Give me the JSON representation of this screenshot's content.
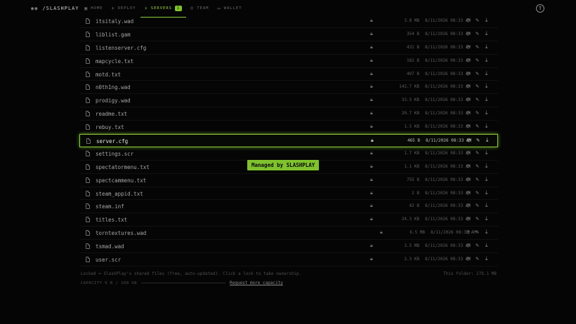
{
  "brand": {
    "logo_icon": "controller-icon",
    "name": "/SLASHPLAY"
  },
  "nav": [
    {
      "label": "HOME",
      "icon": "▣",
      "active": false
    },
    {
      "label": "DEPLOY",
      "icon": "+",
      "active": false
    },
    {
      "label": "SERVERS",
      "icon": "⚡",
      "active": true,
      "badge": "1"
    },
    {
      "label": "TEAM",
      "icon": "☺",
      "active": false
    },
    {
      "label": "WALLET",
      "icon": "▭",
      "active": false
    }
  ],
  "user_initial": "T",
  "files": [
    {
      "name": "itsitaly.wad",
      "size": "3.8 MB",
      "date": "8/11/2026 08:33 AM"
    },
    {
      "name": "liblist.gam",
      "size": "354 B",
      "date": "8/11/2026 08:33 AM"
    },
    {
      "name": "listenserver.cfg",
      "size": "431 B",
      "date": "8/11/2026 08:33 AM"
    },
    {
      "name": "mapcycle.txt",
      "size": "182 B",
      "date": "8/11/2026 08:33 AM"
    },
    {
      "name": "motd.txt",
      "size": "497 B",
      "date": "8/11/2026 08:33 AM"
    },
    {
      "name": "n0th1ng.wad",
      "size": "142.7 KB",
      "date": "8/11/2026 08:33 AM"
    },
    {
      "name": "prodigy.wad",
      "size": "33.5 KB",
      "date": "8/11/2026 08:33 AM"
    },
    {
      "name": "readme.txt",
      "size": "20.7 KB",
      "date": "8/11/2026 08:33 AM"
    },
    {
      "name": "rebuy.txt",
      "size": "1.5 KB",
      "date": "8/11/2026 08:33 AM"
    },
    {
      "name": "server.cfg",
      "size": "465 B",
      "date": "8/11/2026 08:33 AM",
      "selected": true
    },
    {
      "name": "settings.scr",
      "size": "1.7 KB",
      "date": "8/11/2026 08:33 AM"
    },
    {
      "name": "spectatormenu.txt",
      "size": "1.1 KB",
      "date": "8/11/2026 08:33 AM"
    },
    {
      "name": "spectcammenu.txt",
      "size": "755 B",
      "date": "8/11/2026 08:33 AM"
    },
    {
      "name": "steam_appid.txt",
      "size": "2 B",
      "date": "8/11/2026 08:33 AM"
    },
    {
      "name": "steam.inf",
      "size": "42 B",
      "date": "8/11/2026 08:33 AM"
    },
    {
      "name": "titles.txt",
      "size": "24.3 KB",
      "date": "8/11/2026 08:33 AM"
    },
    {
      "name": "torntextures.wad",
      "size": "6.5 MB",
      "date": "8/11/2026 08:33 AM",
      "shift": true
    },
    {
      "name": "tsmad.wad",
      "size": "3.5 MB",
      "date": "8/11/2026 08:33 AM"
    },
    {
      "name": "user.scr",
      "size": "2.3 KB",
      "date": "8/11/2026 08:33 AM"
    }
  ],
  "tooltip": "Managed by SLASHPLAY",
  "footer": {
    "note": "Locked = SlashPlay's shared files (free, auto-updated). Click a lock to take ownership.",
    "folder_total": "This folder: 279.1 MB",
    "capacity": "CAPACITY 0 B / 100 GB",
    "request_link": "Request more capacity"
  },
  "colors": {
    "accent": "#8ed13c",
    "background": "#050505"
  }
}
